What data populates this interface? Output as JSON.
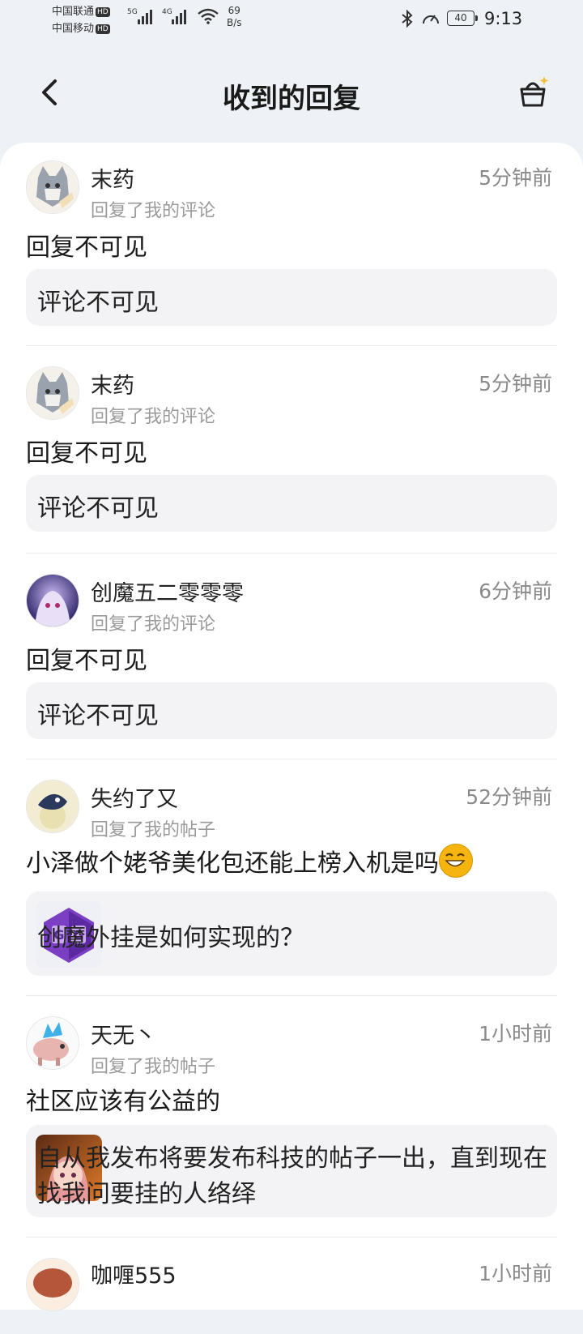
{
  "status_bar": {
    "carrier1": "中国联通",
    "carrier2": "中国移动",
    "hd": "HD",
    "net1": "5G",
    "net2": "4G",
    "speed_value": "69",
    "speed_unit": "B/s",
    "battery": "40",
    "time": "9:13"
  },
  "header": {
    "title": "收到的回复"
  },
  "replies": [
    {
      "user": "末药",
      "time": "5分钟前",
      "action": "回复了我的评论",
      "content": "回复不可见",
      "quote": "评论不可见"
    },
    {
      "user": "末药",
      "time": "5分钟前",
      "action": "回复了我的评论",
      "content": "回复不可见",
      "quote": "评论不可见"
    },
    {
      "user": "创魔五二零零零",
      "time": "6分钟前",
      "action": "回复了我的评论",
      "content": "回复不可见",
      "quote": "评论不可见"
    },
    {
      "user": "失约了又",
      "time": "52分钟前",
      "action": "回复了我的帖子",
      "content": "小泽做个姥爷美化包还能上榜入机是吗",
      "quote": "创魔外挂是如何实现的？"
    },
    {
      "user": "天无丶",
      "time": "1小时前",
      "action": "回复了我的帖子",
      "content": "社区应该有公益的",
      "quote": "自从我发布将要发布科技的帖子一出，直到现在找我问要挂的人络绎"
    },
    {
      "user": "咖喱555",
      "time": "1小时前"
    }
  ],
  "colors": {
    "page_bg": "#eef2f7",
    "card_bg": "#ffffff",
    "quote_bg": "#f3f3f5",
    "muted": "#9a9a9a",
    "gg_purple": "#7b3fc4"
  }
}
